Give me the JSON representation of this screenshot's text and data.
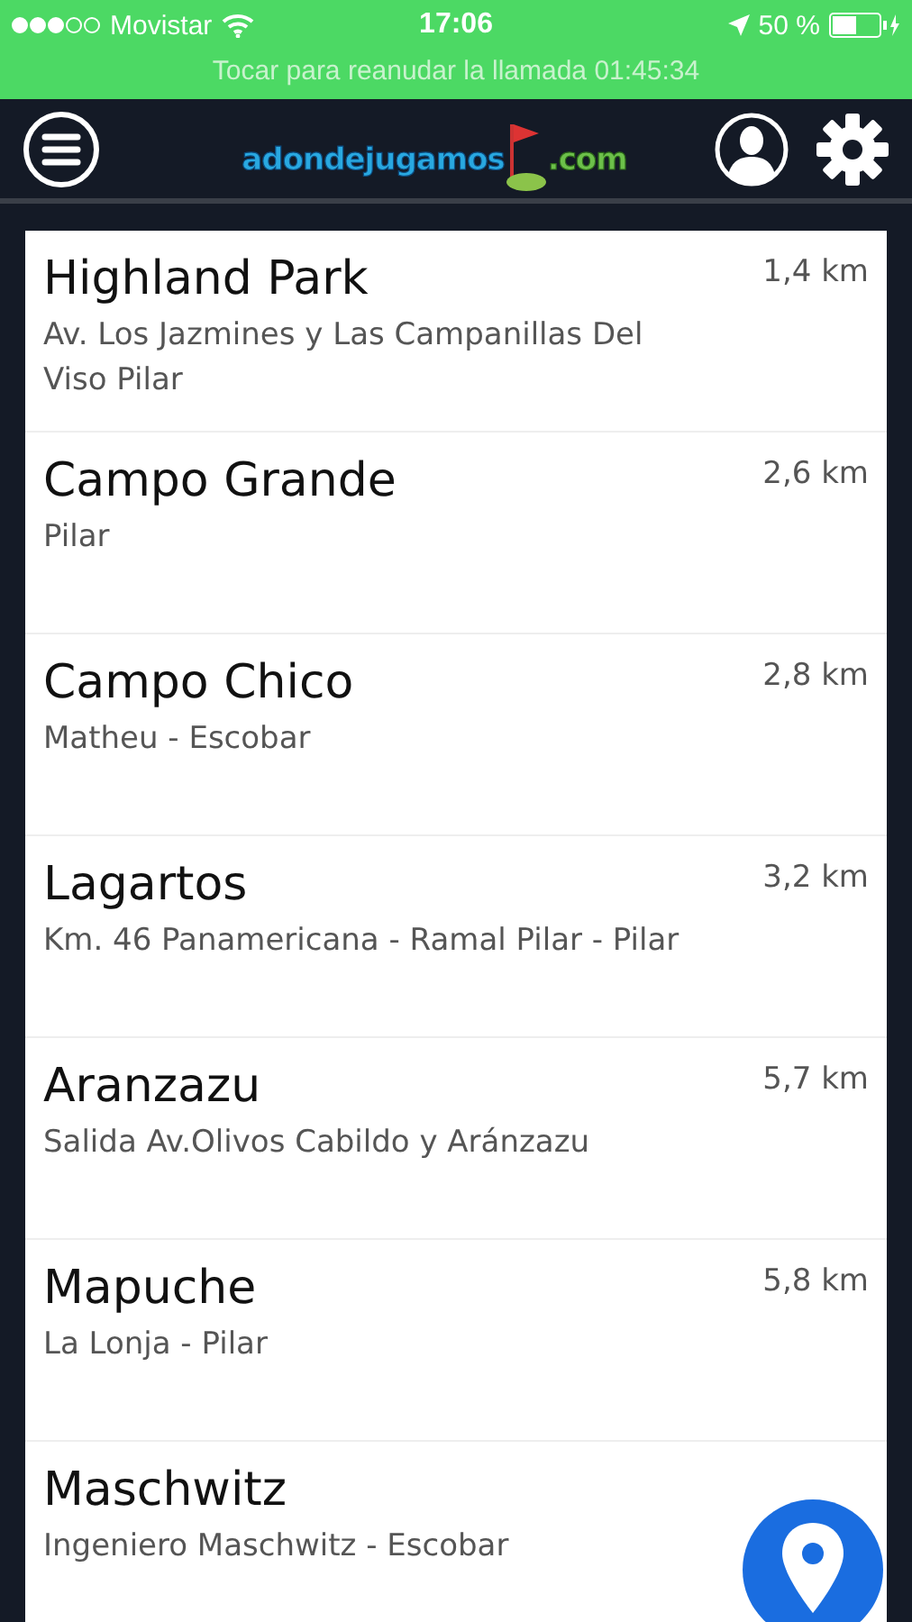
{
  "status_bar": {
    "carrier": "Movistar",
    "time": "17:06",
    "battery": "50 %"
  },
  "call_banner": "Tocar para reanudar la llamada 01:45:34",
  "header": {
    "logo_main": "adondejugamos",
    "logo_suffix": ".com"
  },
  "courses": [
    {
      "name": "Highland Park",
      "address": "Av. Los Jazmines y Las Campanillas Del Viso Pilar",
      "distance": "1,4 km"
    },
    {
      "name": "Campo Grande",
      "address": "Pilar",
      "distance": "2,6 km"
    },
    {
      "name": "Campo Chico",
      "address": "Matheu - Escobar",
      "distance": "2,8 km"
    },
    {
      "name": "Lagartos",
      "address": "Km. 46 Panamericana - Ramal Pilar - Pilar",
      "distance": "3,2 km"
    },
    {
      "name": "Aranzazu",
      "address": "Salida Av.Olivos Cabildo y Aránzazu",
      "distance": "5,7 km"
    },
    {
      "name": "Mapuche",
      "address": "La Lonja - Pilar",
      "distance": "5,8 km"
    },
    {
      "name": "Maschwitz",
      "address": "Ingeniero Maschwitz - Escobar"
    }
  ]
}
